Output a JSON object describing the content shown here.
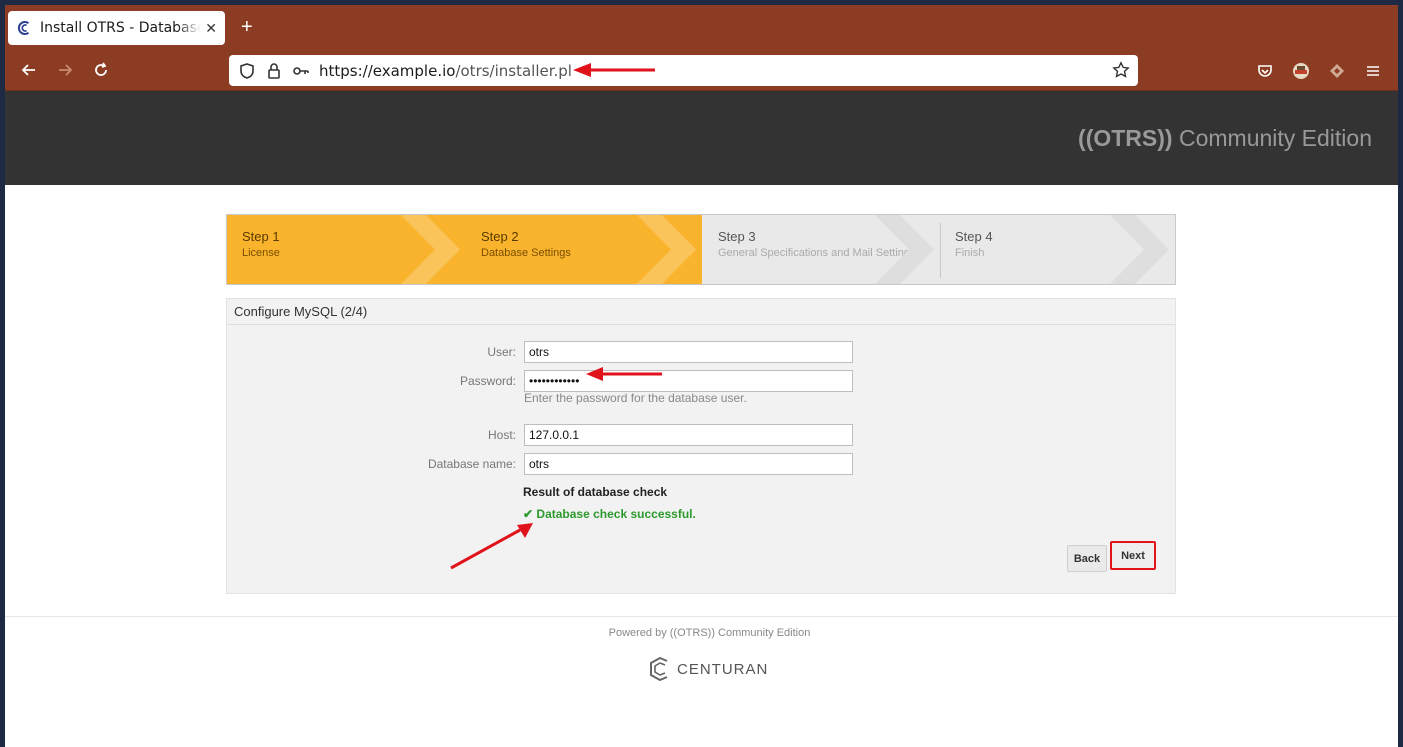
{
  "browser": {
    "tab_title": "Install OTRS - Database Management",
    "url_main": "https://example.io",
    "url_path": "/otrs/installer.pl"
  },
  "header": {
    "brand_strong": "((OTRS))",
    "brand_rest": " Community Edition"
  },
  "steps": [
    {
      "title": "Step 1",
      "subtitle": "License",
      "state": "done"
    },
    {
      "title": "Step 2",
      "subtitle": "Database Settings",
      "state": "current"
    },
    {
      "title": "Step 3",
      "subtitle": "General Specifications and Mail Settings",
      "state": "pending"
    },
    {
      "title": "Step 4",
      "subtitle": "Finish",
      "state": "pending"
    }
  ],
  "form": {
    "heading": "Configure MySQL (2/4)",
    "user_label": "User:",
    "user_value": "otrs",
    "password_label": "Password:",
    "password_value": "••••••••••••",
    "password_hint": "Enter the password for the database user.",
    "host_label": "Host:",
    "host_value": "127.0.0.1",
    "dbname_label": "Database name:",
    "dbname_value": "otrs",
    "check_title": "Result of database check",
    "check_result": "Database check successful.",
    "back_label": "Back",
    "next_label": "Next"
  },
  "footer": {
    "powered": "Powered by ((OTRS)) Community Edition",
    "vendor": "CENTURAN"
  },
  "colors": {
    "chrome": "#8b3c22",
    "active_step": "#f9b32c",
    "success": "#2d9a2d",
    "highlight": "#e0131b"
  }
}
